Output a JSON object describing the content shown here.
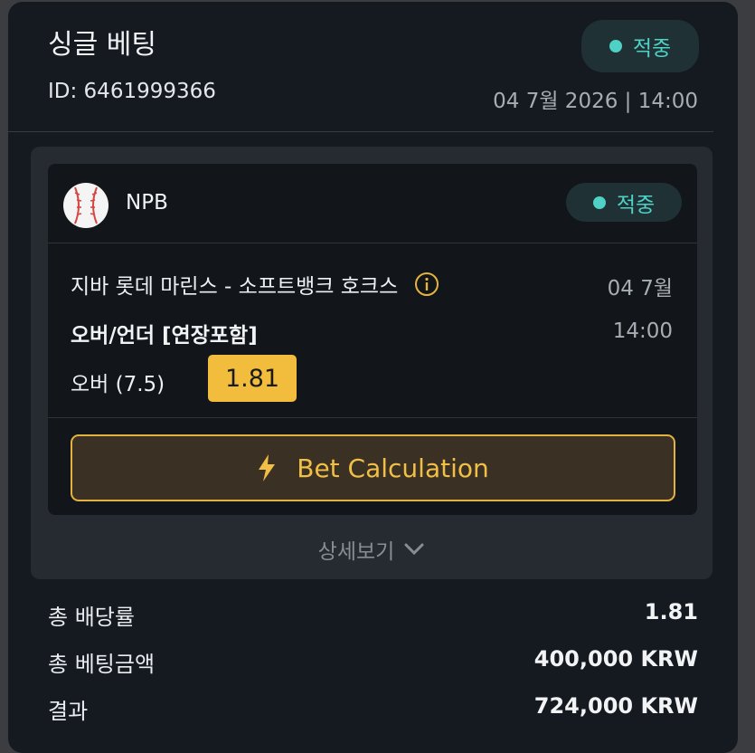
{
  "header": {
    "title": "싱글 베팅",
    "bet_id": "ID: 6461999366",
    "status": "적중",
    "datetime": "04 7월 2026 | 14:00"
  },
  "bet": {
    "league": "NPB",
    "league_icon": "baseball-icon",
    "status": "적중",
    "match": "지바 롯데 마린스 - 소프트뱅크 호크스",
    "date": "04 7월",
    "market": "오버/언더 [연장포함]",
    "time": "14:00",
    "selection": "오버 (7.5)",
    "odds": "1.81",
    "calc_button": "Bet Calculation",
    "details_label": "상세보기"
  },
  "summary": [
    {
      "label": "총 배당률",
      "value": "1.81"
    },
    {
      "label": "총 베팅금액",
      "value": "400,000 KRW"
    },
    {
      "label": "결과",
      "value": "724,000 KRW"
    }
  ],
  "colors": {
    "accent": "#f2bd3d",
    "success": "#4fd1c5",
    "card_bg": "#151a21"
  }
}
